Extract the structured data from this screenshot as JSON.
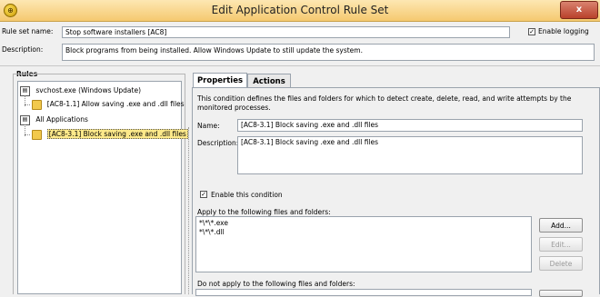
{
  "window": {
    "title": "Edit Application Control Rule Set",
    "close_label": "x"
  },
  "top_strip_text": "...",
  "rule_set": {
    "name_label": "Rule set name:",
    "name_value": "Stop software installers [AC8]",
    "enable_logging_label": "Enable logging",
    "enable_logging_checked": true,
    "description_label": "Description:",
    "description_value": "Block programs from being installed.  Allow Windows Update to still update the system."
  },
  "rules": {
    "header": "Rules",
    "items": [
      {
        "label": "svchost.exe (Windows Update)",
        "level": 0,
        "type": "application"
      },
      {
        "label": "[AC8-1.1] Allow saving .exe and .dll files",
        "level": 1,
        "type": "condition"
      },
      {
        "label": "All Applications",
        "level": 0,
        "type": "application"
      },
      {
        "label": "[AC8-3.1] Block saving .exe and .dll files",
        "level": 1,
        "type": "condition",
        "selected": true
      }
    ]
  },
  "tabs": [
    {
      "label": "Properties",
      "active": true
    },
    {
      "label": "Actions",
      "active": false
    }
  ],
  "properties": {
    "intro": "This condition defines the files and folders for which to detect create, delete, read, and write attempts by the monitored processes.",
    "name_label": "Name:",
    "name_value": "[AC8-3.1] Block saving .exe and .dll files",
    "description_label": "Description:",
    "description_value": "[AC8-3.1] Block saving .exe and .dll files",
    "enable_condition_label": "Enable this condition",
    "enable_condition_checked": true,
    "apply_label": "Apply to the following files and folders:",
    "apply_items": [
      "*\\*\\*.exe",
      "*\\*\\*.dll"
    ],
    "add_label": "Add...",
    "edit_label": "Edit...",
    "delete_label": "Delete",
    "not_apply_label": "Do not apply to the following files and folders:"
  },
  "colors": {
    "selection": "#fde98a",
    "titlebar": "#f5c970"
  }
}
